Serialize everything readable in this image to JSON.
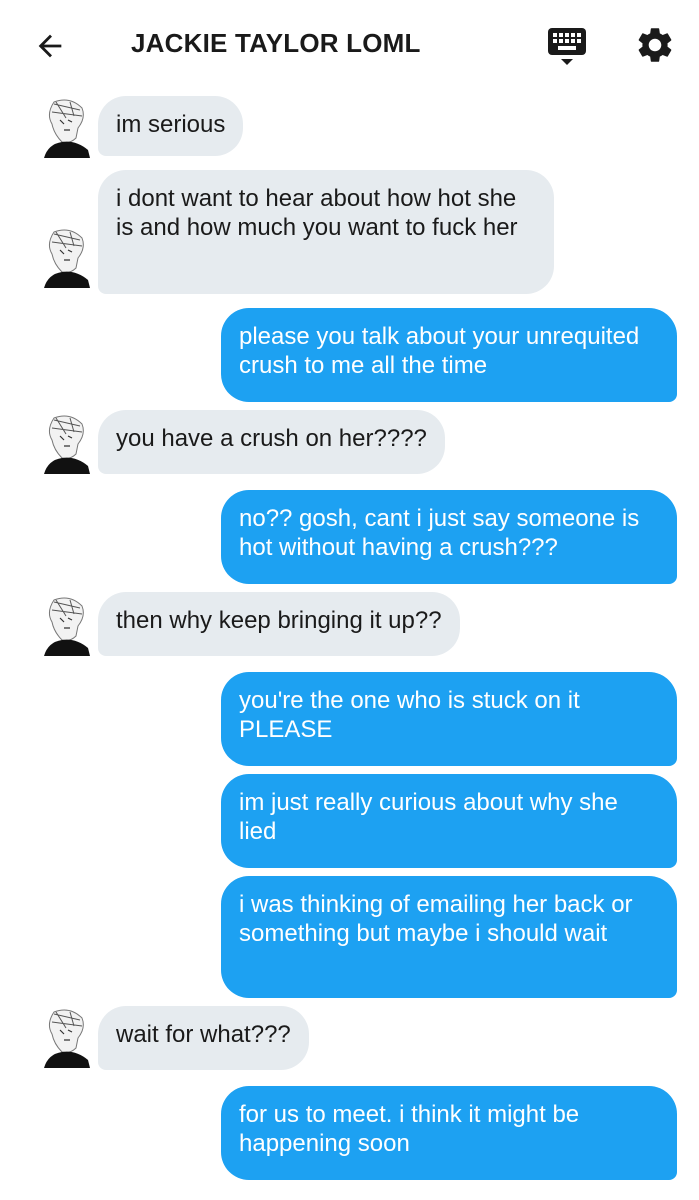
{
  "header": {
    "title": "JACKIE TAYLOR LOML",
    "back_icon": "arrow-left-icon",
    "keyboard_icon": "keyboard-icon",
    "settings_icon": "gear-icon"
  },
  "colors": {
    "incoming_bubble": "#e6ebef",
    "outgoing_bubble": "#1da1f2",
    "outgoing_text": "#ffffff",
    "incoming_text": "#1a1a1a"
  },
  "messages": [
    {
      "direction": "in",
      "text": "im serious"
    },
    {
      "direction": "in",
      "text": "i dont want to hear about how hot she is and how much you want to fuck her"
    },
    {
      "direction": "out",
      "text": "please you talk about your unrequited crush to me all the time"
    },
    {
      "direction": "in",
      "text": "you have a crush on her????"
    },
    {
      "direction": "out",
      "text": "no?? gosh, cant i just say someone is hot without having a crush???"
    },
    {
      "direction": "in",
      "text": "then why keep bringing it up??"
    },
    {
      "direction": "out",
      "text": "you're the one who is stuck on it PLEASE"
    },
    {
      "direction": "out",
      "text": "im just really curious about why she lied"
    },
    {
      "direction": "out",
      "text": "i was thinking of emailing her back or something but maybe i should wait"
    },
    {
      "direction": "in",
      "text": "wait for what???"
    },
    {
      "direction": "out",
      "text": "for us to meet. i think it might be happening soon"
    }
  ]
}
